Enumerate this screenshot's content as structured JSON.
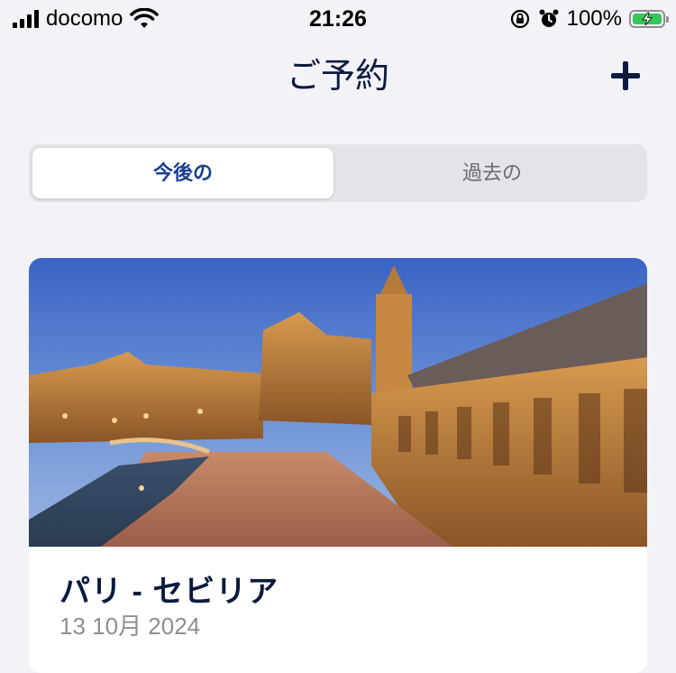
{
  "status_bar": {
    "carrier": "docomo",
    "time": "21:26",
    "battery": "100%",
    "battery_level": 1.0
  },
  "nav": {
    "title": "ご予約",
    "add_icon": "plus-icon"
  },
  "tabs": [
    {
      "label": "今後の",
      "selected": true
    },
    {
      "label": "過去の",
      "selected": false
    }
  ],
  "booking": {
    "route": "パリ - セビリア",
    "date": "13 10月 2024",
    "image": "plaza-de-espana-seville"
  },
  "colors": {
    "brand_navy": "#0b1a3f",
    "accent_blue": "#1a3f8f",
    "battery_green": "#34c759"
  }
}
